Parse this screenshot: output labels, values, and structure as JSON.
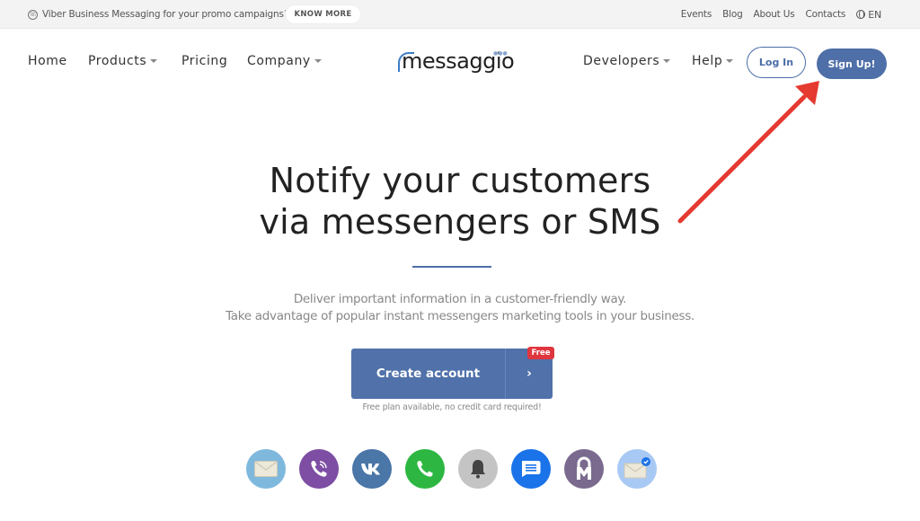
{
  "topbar": {
    "promo_text": "Viber Business Messaging for your promo campaigns!",
    "promo_icon": "viber-icon",
    "know_more_label": "KNOW MORE",
    "links": [
      "Events",
      "Blog",
      "About Us",
      "Contacts"
    ],
    "language": "EN",
    "language_icon": "globe-icon"
  },
  "nav": {
    "items": [
      {
        "label": "Home",
        "dropdown": false
      },
      {
        "label": "Products",
        "dropdown": true
      },
      {
        "label": "Pricing",
        "dropdown": false
      },
      {
        "label": "Company",
        "dropdown": true
      }
    ],
    "logo_text": "messaggio",
    "right_items": [
      {
        "label": "Developers",
        "dropdown": true
      },
      {
        "label": "Help",
        "dropdown": true
      }
    ],
    "login_label": "Log In",
    "signup_label": "Sign Up!"
  },
  "hero": {
    "title_line1": "Notify your customers",
    "title_line2": "via messengers or SMS",
    "subtitle_line1": "Deliver important information in a customer-friendly way.",
    "subtitle_line2": "Take advantage of popular instant messengers marketing tools in your business.",
    "cta_label": "Create account",
    "cta_arrow": "›",
    "badge": "Free",
    "cta_note": "Free plan available, no credit card required!"
  },
  "channels": [
    {
      "name": "email",
      "icon": "envelope-icon",
      "color": "#7fb8dd"
    },
    {
      "name": "viber",
      "icon": "viber-icon",
      "color": "#7d4ea3"
    },
    {
      "name": "vk",
      "icon": "vk-icon",
      "color": "#4a76a8"
    },
    {
      "name": "whatsapp",
      "icon": "phone-icon",
      "color": "#2db742"
    },
    {
      "name": "push",
      "icon": "bell-icon",
      "color": "#c4c4c4"
    },
    {
      "name": "rcs",
      "icon": "message-icon",
      "color": "#1a73e8"
    },
    {
      "name": "mail-ru",
      "icon": "lock-m-icon",
      "color": "#7a6a8e"
    },
    {
      "name": "verified-email",
      "icon": "verified-envelope-icon",
      "color": "#a9c9f5"
    }
  ],
  "colors": {
    "brand_blue": "#4e6fa8",
    "badge_red": "#e0363e",
    "annotation_red": "#e53a30"
  }
}
